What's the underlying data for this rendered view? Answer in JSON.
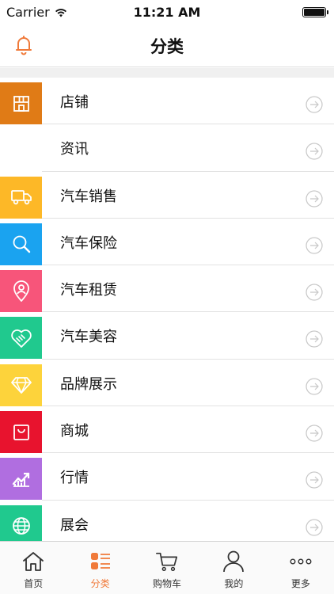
{
  "status": {
    "carrier": "Carrier",
    "time": "11:21 AM"
  },
  "nav": {
    "title": "分类"
  },
  "categories": [
    {
      "label": "店铺",
      "icon": "store-icon",
      "color": "#e07b16"
    },
    {
      "label": "资讯",
      "icon": "",
      "color": ""
    },
    {
      "label": "汽车销售",
      "icon": "truck-icon",
      "color": "#fdb827"
    },
    {
      "label": "汽车保险",
      "icon": "search-icon",
      "color": "#1aa3f0"
    },
    {
      "label": "汽车租赁",
      "icon": "location-pin-icon",
      "color": "#f7557a"
    },
    {
      "label": "汽车美容",
      "icon": "heart-handshake-icon",
      "color": "#20c98e"
    },
    {
      "label": "品牌展示",
      "icon": "diamond-icon",
      "color": "#fdd33b"
    },
    {
      "label": "商城",
      "icon": "shopping-bag-icon",
      "color": "#e8132e"
    },
    {
      "label": "行情",
      "icon": "trend-chart-icon",
      "color": "#b06ee0"
    },
    {
      "label": "展会",
      "icon": "globe-icon",
      "color": "#20c98e"
    }
  ],
  "tabs": [
    {
      "label": "首页",
      "icon": "home-icon"
    },
    {
      "label": "分类",
      "icon": "category-list-icon",
      "active": true
    },
    {
      "label": "购物车",
      "icon": "cart-icon"
    },
    {
      "label": "我的",
      "icon": "user-icon"
    },
    {
      "label": "更多",
      "icon": "more-icon"
    }
  ],
  "colors": {
    "accent": "#f07a3a",
    "arrow": "#c8c8c8"
  }
}
